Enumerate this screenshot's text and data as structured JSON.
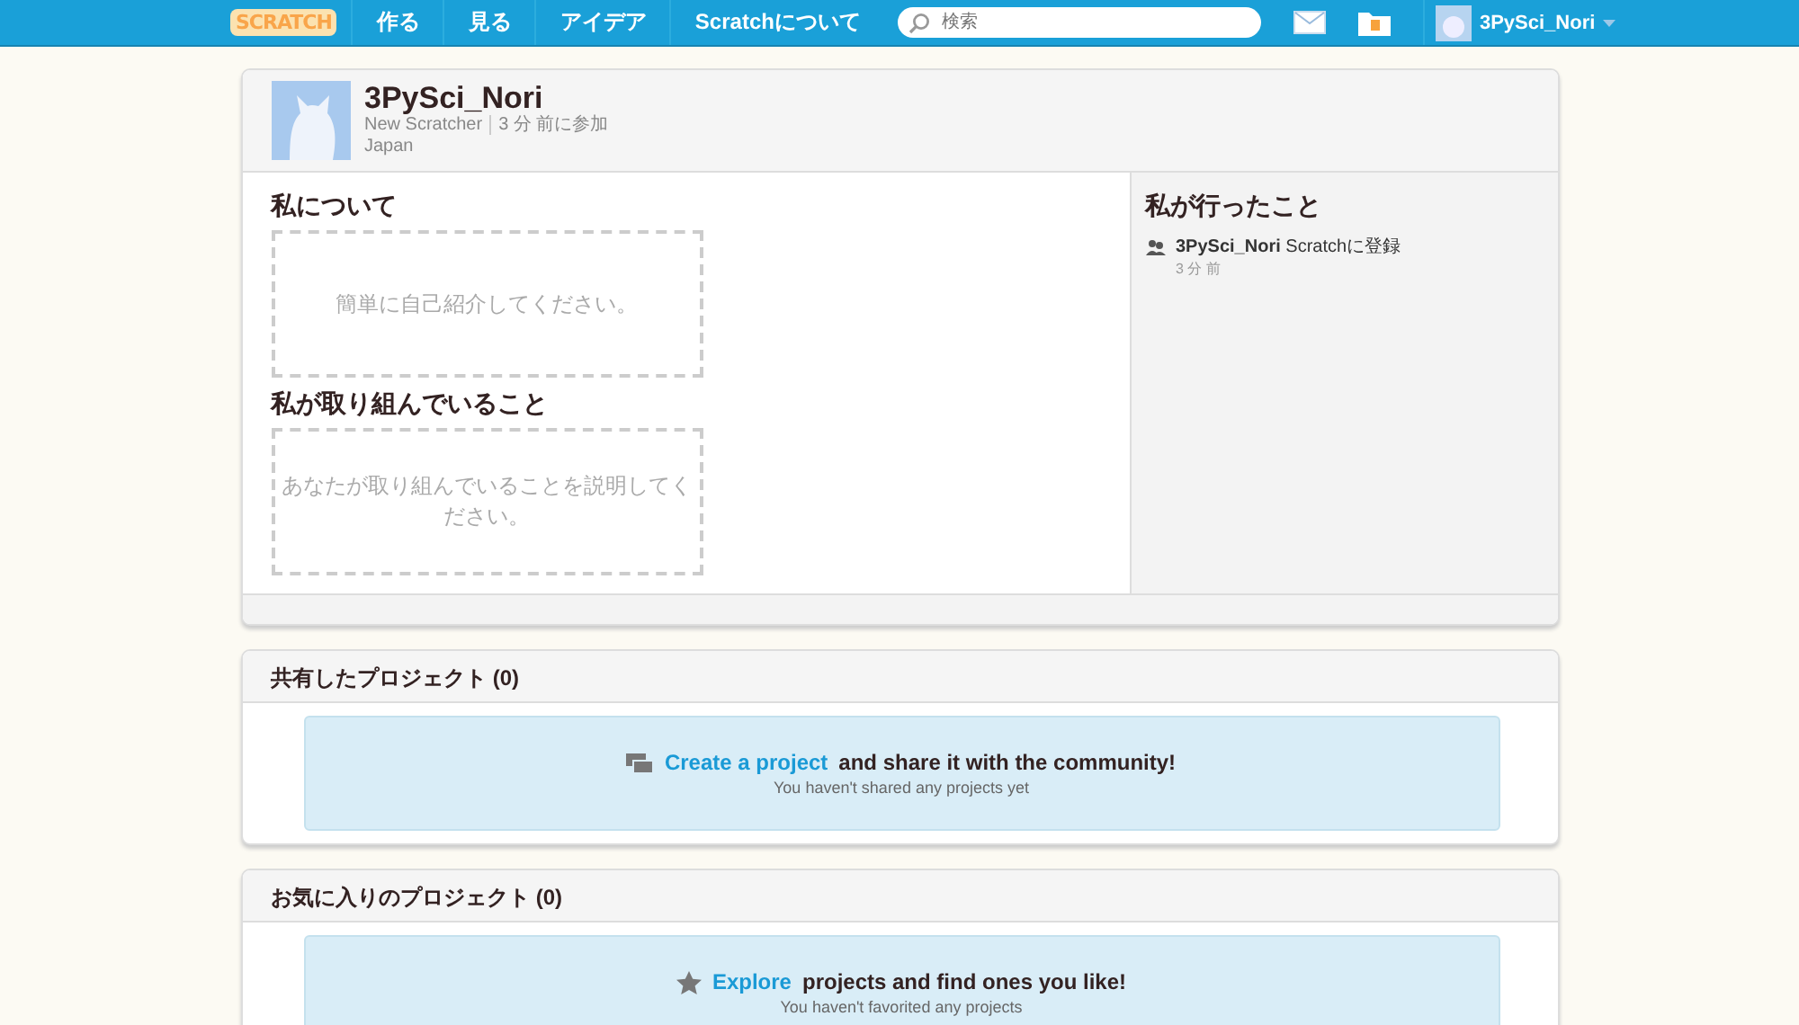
{
  "nav": {
    "logo": "SCRATCH",
    "items": [
      "作る",
      "見る",
      "アイデア",
      "Scratchについて"
    ],
    "search": {
      "placeholder": "検索"
    },
    "user": "3PySci_Nori"
  },
  "profile": {
    "username": "3PySci_Nori",
    "status": "New Scratcher",
    "joined": "3 分 前に参加",
    "location": "Japan"
  },
  "about": {
    "title": "私について",
    "placeholder": "簡単に自己紹介してください。"
  },
  "working": {
    "title": "私が取り組んでいること",
    "placeholder": "あなたが取り組んでいることを説明してください。"
  },
  "activity": {
    "title": "私が行ったこと",
    "items": [
      {
        "user": "3PySci_Nori",
        "action": "Scratchに登録",
        "time": "3 分 前"
      }
    ]
  },
  "sections": [
    {
      "kind": "shared",
      "title": "共有したプロジェクト",
      "count": "(0)",
      "link": "Create a project",
      "text": "and share it with the community!",
      "note": "You haven't shared any projects yet"
    },
    {
      "kind": "favorites",
      "title": "お気に入りのプロジェクト",
      "count": "(0)",
      "link": "Explore",
      "text": "projects and find ones you like!",
      "note": "You haven't favorited any projects"
    }
  ]
}
